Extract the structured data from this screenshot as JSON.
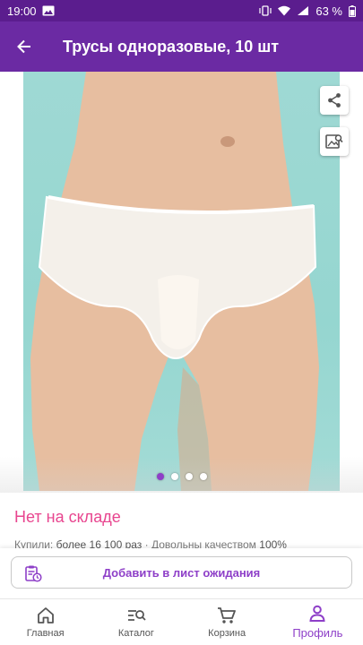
{
  "status_bar": {
    "time": "19:00",
    "battery": "63 %",
    "icons": [
      "image-icon",
      "vibrate-icon",
      "wifi-icon",
      "signal-icon",
      "battery-icon"
    ]
  },
  "app_bar": {
    "title": "Трусы одноразовые, 10 шт",
    "back_icon": "arrow-back-icon"
  },
  "gallery": {
    "image_count": 4,
    "active_index": 0,
    "share_icon": "share-icon",
    "image_search_icon": "image-search-icon"
  },
  "product": {
    "stock_status": "Нет на складе",
    "bought_label": "Купили:",
    "bought_value": "более 16 100 раз",
    "separator": "·",
    "quality_label": "Довольны качеством",
    "quality_value": "100%"
  },
  "waitlist_button": {
    "label": "Добавить в лист ожидания",
    "icon": "clipboard-clock-icon"
  },
  "bottom_nav": {
    "items": [
      {
        "label": "Главная",
        "icon": "home-icon"
      },
      {
        "label": "Каталог",
        "icon": "catalog-search-icon"
      },
      {
        "label": "Корзина",
        "icon": "cart-icon"
      },
      {
        "label": "Профиль",
        "icon": "profile-icon"
      }
    ],
    "active_index": 3
  },
  "colors": {
    "status_bar": "#5b1d8e",
    "app_bar": "#6b2aa3",
    "accent": "#8e3fc8",
    "stock_pink": "#e8458f",
    "photo_bg": "#9fd9d4"
  }
}
